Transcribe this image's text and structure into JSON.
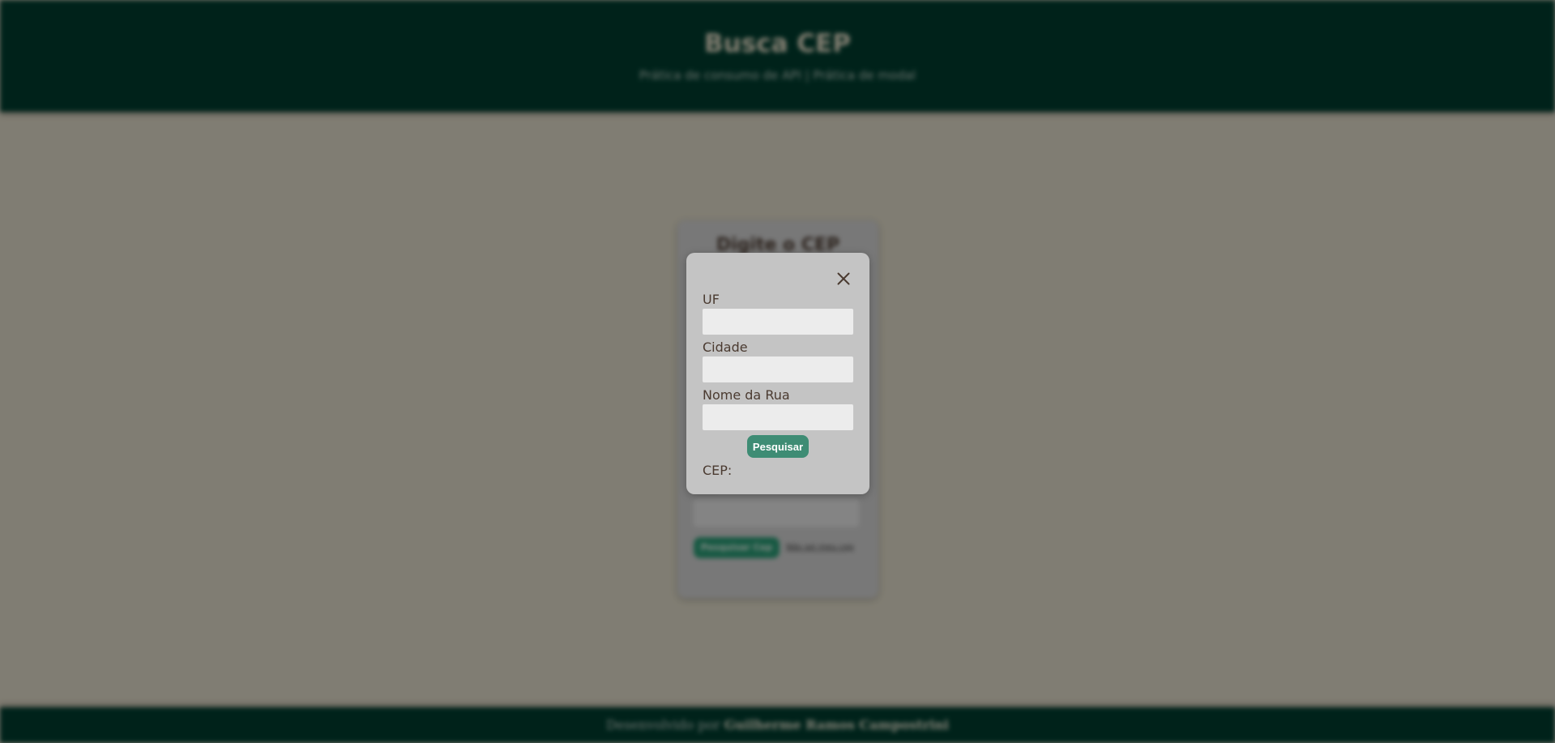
{
  "header": {
    "title": "Busca CEP",
    "subtitle": "Prática de consumo de API | Prática de modal"
  },
  "card": {
    "title": "Digite o CEP",
    "search_label": "Pesquisar Cep",
    "link_text": "Não sei meu cep"
  },
  "footer": {
    "prefix": "Desenvolvido por",
    "author": "Guilherme Ramos Campostrini"
  },
  "modal": {
    "close_icon": "close-icon",
    "uf_label": "UF",
    "uf_value": "",
    "city_label": "Cidade",
    "city_value": "",
    "street_label": "Nome da Rua",
    "street_value": "",
    "search_button": "Pesquisar",
    "cep_label": "CEP:"
  },
  "colors": {
    "header_bg": "#003c2e",
    "accent_button": "#3e8c74",
    "modal_bg": "#c4c4c4",
    "text_brown": "#4a3a30"
  }
}
